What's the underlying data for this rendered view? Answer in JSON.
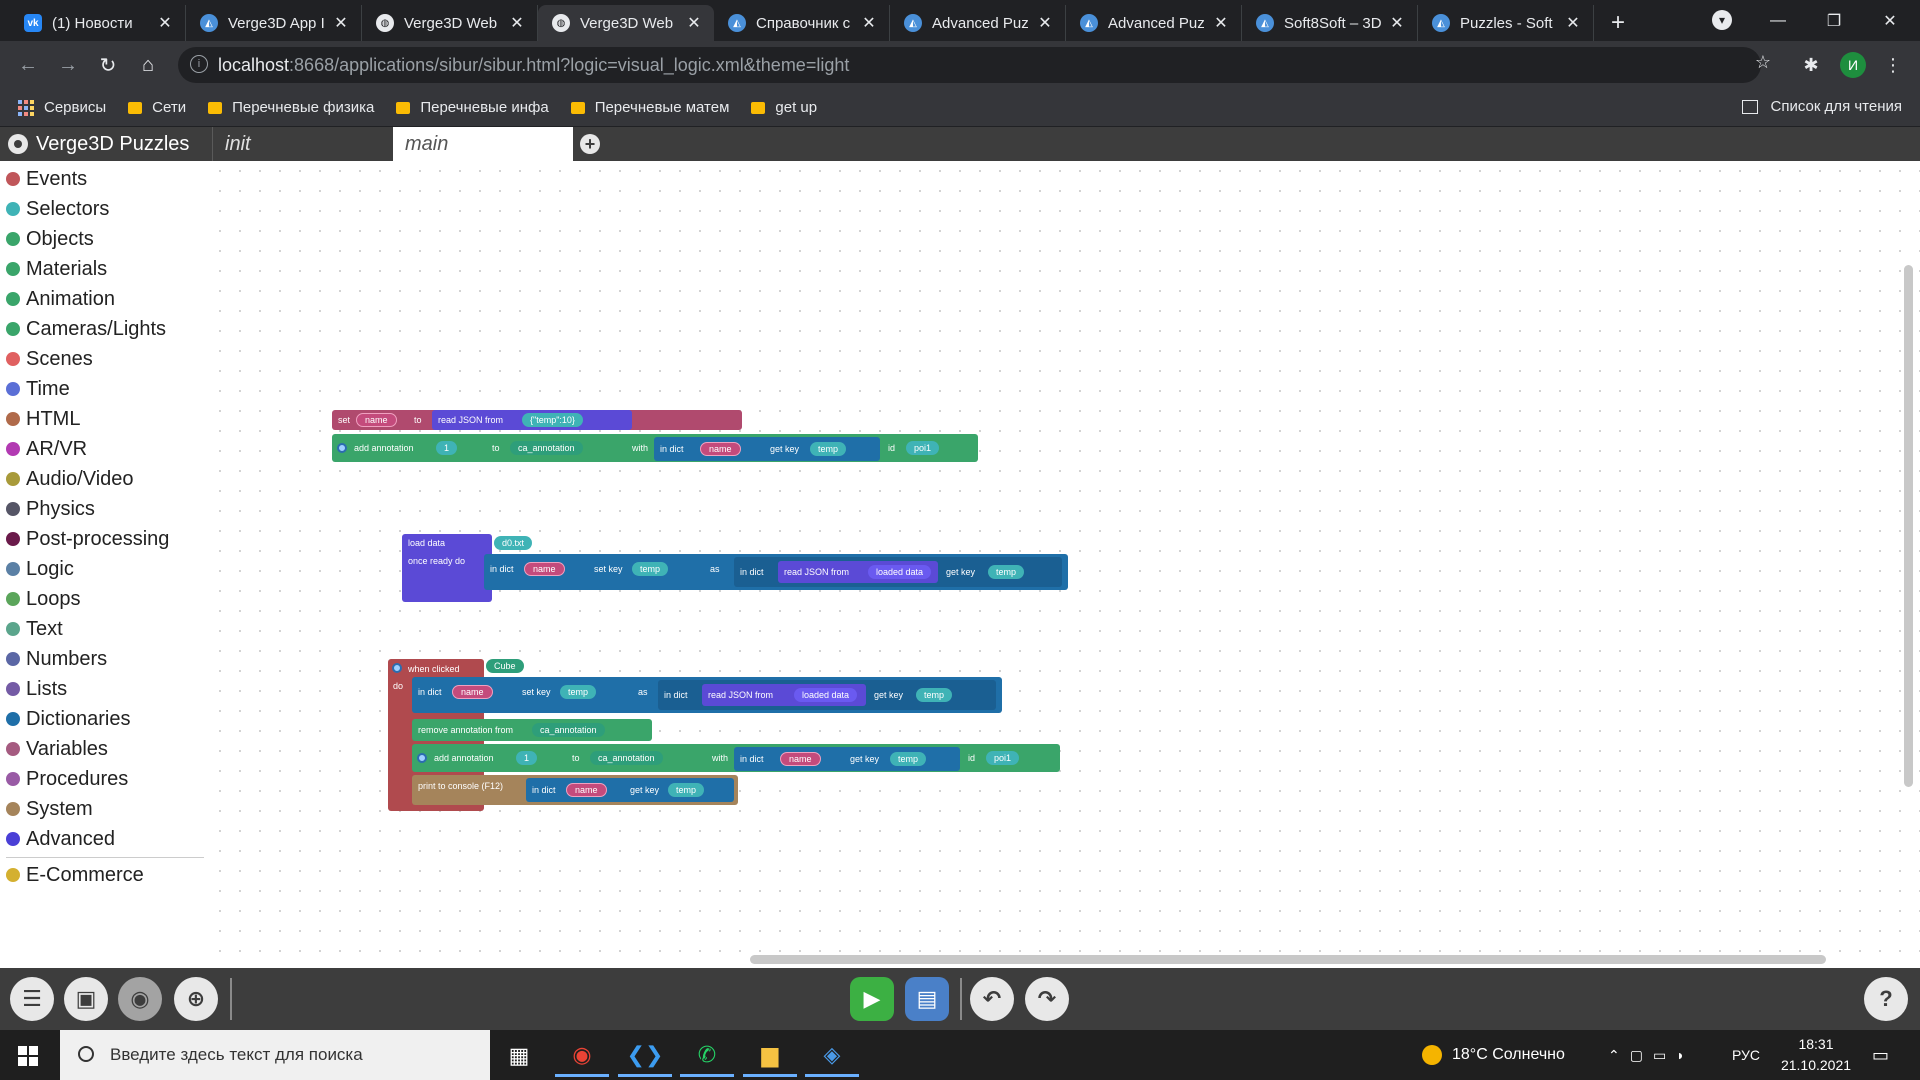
{
  "browser": {
    "tabs": [
      {
        "title": "(1) Новости",
        "icon": "vk-icon"
      },
      {
        "title": "Verge3D App I",
        "icon": "verge3d-icon"
      },
      {
        "title": "Verge3D Web",
        "icon": "globe-icon"
      },
      {
        "title": "Verge3D Web",
        "icon": "globe-icon"
      },
      {
        "title": "Справочник с",
        "icon": "verge3d-icon"
      },
      {
        "title": "Advanced Puz",
        "icon": "verge3d-icon"
      },
      {
        "title": "Advanced Puz",
        "icon": "verge3d-icon"
      },
      {
        "title": "Soft8Soft – 3D",
        "icon": "verge3d-icon"
      },
      {
        "title": "Puzzles - Soft",
        "icon": "verge3d-icon"
      }
    ],
    "active_tab": 3,
    "url_host": "localhost",
    "url_rest": ":8668/applications/sibur/sibur.html?logic=visual_logic.xml&theme=light",
    "bookmarks": [
      "Сервисы",
      "Сети",
      "Перечневые физика",
      "Перечневые инфа",
      "Перечневые матем",
      "get up"
    ],
    "reading_list": "Список для чтения",
    "avatar_letter": "И"
  },
  "puzzles": {
    "app_title": "Verge3D Puzzles",
    "tabs": [
      "init",
      "main"
    ],
    "categories": [
      {
        "label": "Events",
        "color": "#c0565a"
      },
      {
        "label": "Selectors",
        "color": "#3fb3b6"
      },
      {
        "label": "Objects",
        "color": "#3aa56a"
      },
      {
        "label": "Materials",
        "color": "#3aa56a"
      },
      {
        "label": "Animation",
        "color": "#3aa56a"
      },
      {
        "label": "Cameras/Lights",
        "color": "#3aa56a"
      },
      {
        "label": "Scenes",
        "color": "#e06060"
      },
      {
        "label": "Time",
        "color": "#5b6fd6"
      },
      {
        "label": "HTML",
        "color": "#b06a4a"
      },
      {
        "label": "AR/VR",
        "color": "#b23ab2"
      },
      {
        "label": "Audio/Video",
        "color": "#a89a3a"
      },
      {
        "label": "Physics",
        "color": "#555566"
      },
      {
        "label": "Post-processing",
        "color": "#6a1a4a"
      },
      {
        "label": "Logic",
        "color": "#5b80a5"
      },
      {
        "label": "Loops",
        "color": "#5ba55b"
      },
      {
        "label": "Text",
        "color": "#5ba58c"
      },
      {
        "label": "Numbers",
        "color": "#5b67a5"
      },
      {
        "label": "Lists",
        "color": "#745ba5"
      },
      {
        "label": "Dictionaries",
        "color": "#1f6fa8"
      },
      {
        "label": "Variables",
        "color": "#a55b80"
      },
      {
        "label": "Procedures",
        "color": "#995ba5"
      },
      {
        "label": "System",
        "color": "#a5845b"
      },
      {
        "label": "Advanced",
        "color": "#4a3fd6"
      }
    ],
    "extra_category": {
      "label": "E-Commerce",
      "color": "#d4b030"
    }
  },
  "blocks": {
    "group1": {
      "set": "set",
      "set_var": "name",
      "to": "to",
      "read_json": "read JSON from",
      "json_str": "{\"temp\":10}",
      "add_annotation": "add annotation",
      "ann_num": "1",
      "to2": "to",
      "ann_obj": "ca_annotation",
      "with": "with",
      "in_dict": "in dict",
      "dict_var": "name",
      "get_key": "get key",
      "key": "temp",
      "id": "id",
      "id_val": "poi1"
    },
    "group2": {
      "load_data": "load data",
      "file": "d0.txt",
      "once_ready": "once ready do",
      "in_dict": "in dict",
      "dict_var": "name",
      "set_key": "set key",
      "key": "temp",
      "as": "as",
      "in_dict2": "in dict",
      "read_json": "read JSON from",
      "loaded": "loaded data",
      "get_key": "get key",
      "key2": "temp"
    },
    "group3": {
      "when_clicked": "when clicked",
      "object": "Cube",
      "do": "do",
      "in_dict": "in dict",
      "dict_var": "name",
      "set_key": "set key",
      "key": "temp",
      "as": "as",
      "in_dict2": "in dict",
      "read_json": "read JSON from",
      "loaded": "loaded data",
      "get_key": "get key",
      "key2": "temp",
      "remove_ann": "remove annotation from",
      "ann_obj": "ca_annotation",
      "add_annotation": "add annotation",
      "ann_num": "1",
      "to": "to",
      "ann_obj2": "ca_annotation",
      "with": "with",
      "in_dict3": "in dict",
      "dict_var2": "name",
      "get_key2": "get key",
      "key3": "temp",
      "id": "id",
      "id_val": "poi1",
      "print": "print to console (F12)",
      "in_dict4": "in dict",
      "dict_var3": "name",
      "get_key3": "get key",
      "key4": "temp"
    }
  },
  "taskbar": {
    "search_placeholder": "Введите здесь текст для поиска",
    "weather": "18°C  Солнечно",
    "lang": "РУС",
    "time": "18:31",
    "date": "21.10.2021"
  }
}
